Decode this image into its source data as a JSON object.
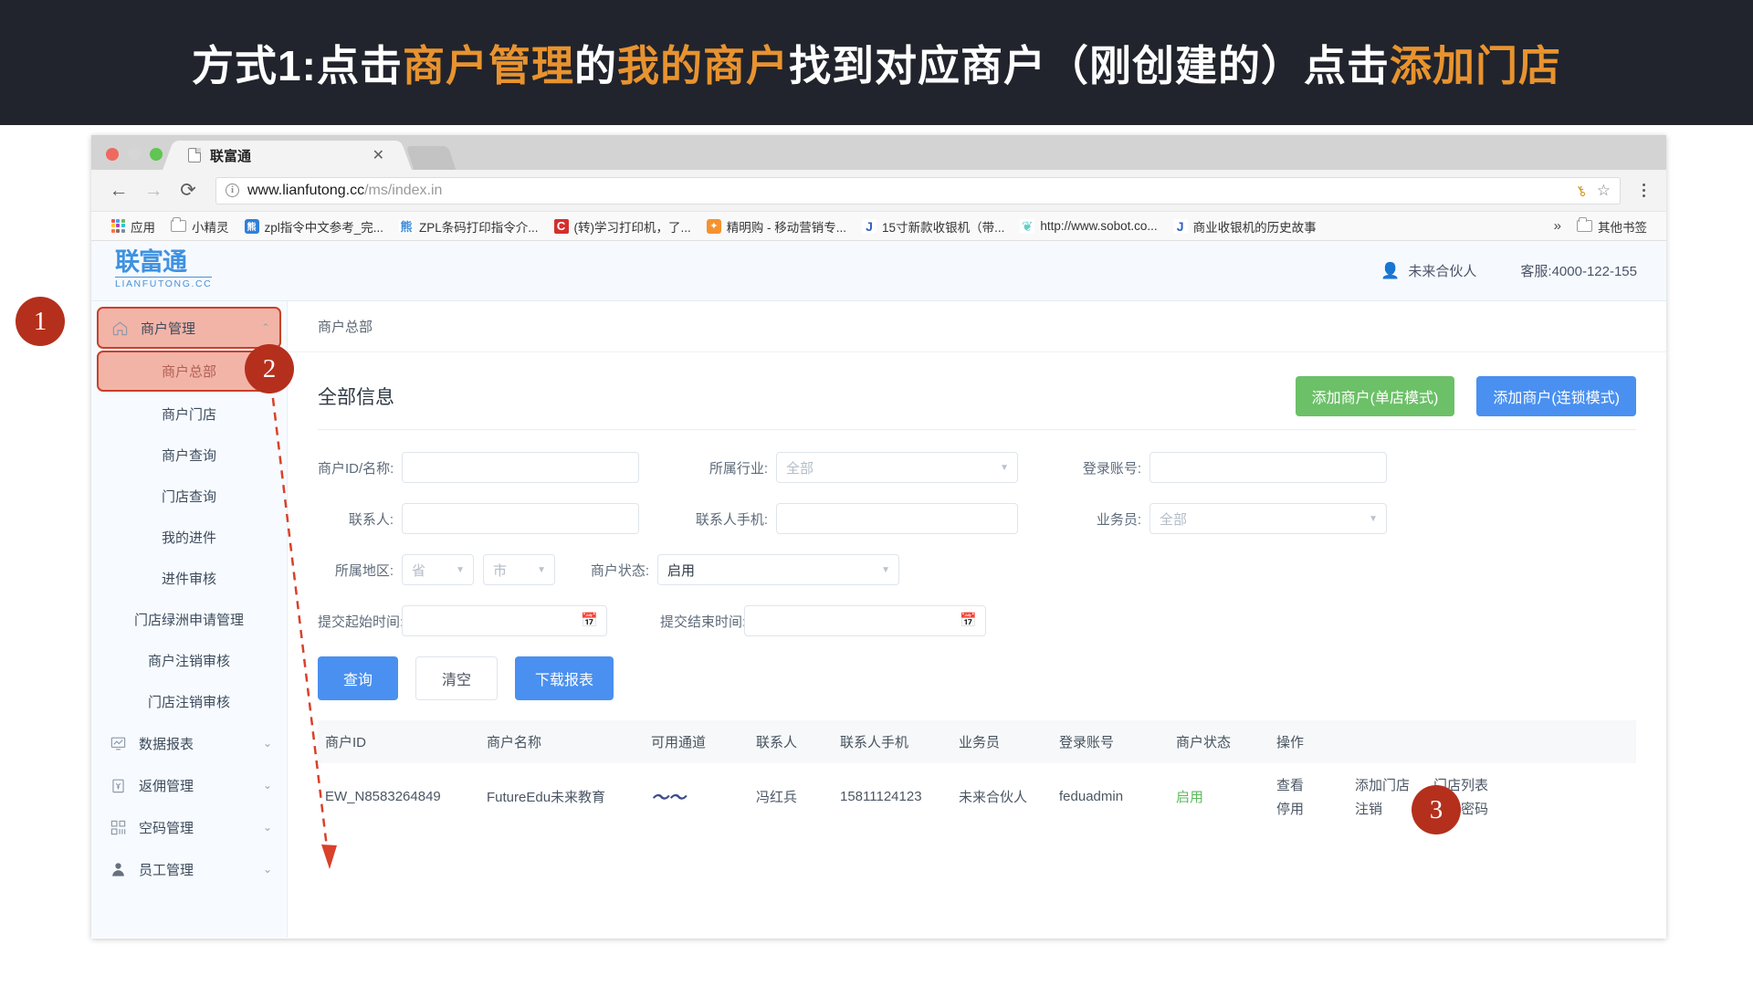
{
  "banner": {
    "seg1": "方式1:点击",
    "hl1": "商户管理",
    "seg2": "的",
    "hl2": "我的商户",
    "seg3": "找到对应商户（刚创建的）点击",
    "hl3": "添加门店"
  },
  "browser": {
    "tab_title": "联富通",
    "tab_close": "✕",
    "back": "←",
    "forward": "→",
    "reload": "⟳",
    "url_host": "www.lianfutong.cc",
    "url_path": "/ms/index.in",
    "info_icon": "i",
    "key_icon": "⚷",
    "star_icon": "☆",
    "bookmarks": [
      {
        "label": "应用",
        "icon": "apps-grid-icon"
      },
      {
        "label": "小精灵",
        "icon": "folder-icon"
      },
      {
        "label": "zpl指令中文参考_完...",
        "icon": "baidu-icon"
      },
      {
        "label": "ZPL条码打印指令介...",
        "icon": "baidu-alt-icon"
      },
      {
        "label": "(转)学习打印机，了...",
        "icon": "csdn-icon"
      },
      {
        "label": "精明购 - 移动营销专...",
        "icon": "orange-bag-icon"
      },
      {
        "label": "15寸新款收银机（带...",
        "icon": "jd-icon"
      },
      {
        "label": "http://www.sobot.co...",
        "icon": "tooth-icon"
      },
      {
        "label": "商业收银机的历史故事",
        "icon": "jd-icon"
      }
    ],
    "more_chevron": "»",
    "other_bookmarks": "其他书签",
    "other_bookmarks_icon": "folder-icon"
  },
  "site": {
    "logo_main": "联富通",
    "logo_sub": "LIANFUTONG.CC",
    "user_name": "未来合伙人",
    "user_icon": "user-avatar-icon",
    "service": "客服:4000-122-155",
    "breadcrumb": "商户总部"
  },
  "sidebar": {
    "groups": [
      {
        "label": "商户管理",
        "icon": "home-icon",
        "caret": "⌃",
        "active": true,
        "children": [
          {
            "label": "商户总部",
            "active": true
          },
          {
            "label": "商户门店",
            "active": false
          },
          {
            "label": "商户查询",
            "active": false
          },
          {
            "label": "门店查询",
            "active": false
          },
          {
            "label": "我的进件",
            "active": false
          },
          {
            "label": "进件审核",
            "active": false
          },
          {
            "label": "门店绿洲申请管理",
            "active": false
          },
          {
            "label": "商户注销审核",
            "active": false
          },
          {
            "label": "门店注销审核",
            "active": false
          }
        ]
      },
      {
        "label": "数据报表",
        "icon": "chart-monitor-icon",
        "caret": "⌄",
        "active": false,
        "children": []
      },
      {
        "label": "返佣管理",
        "icon": "yuan-note-icon",
        "caret": "⌄",
        "active": false,
        "children": []
      },
      {
        "label": "空码管理",
        "icon": "qrcode-icon",
        "caret": "⌄",
        "active": false,
        "children": []
      },
      {
        "label": "员工管理",
        "icon": "user-icon",
        "caret": "⌄",
        "active": false,
        "children": []
      }
    ]
  },
  "panel": {
    "title": "全部信息",
    "btn_single": "添加商户(单店模式)",
    "btn_chain": "添加商户(连锁模式)",
    "color_green": "#6cc068",
    "color_blue": "#4a90f0"
  },
  "form": {
    "merchant_id_label": "商户ID/名称:",
    "merchant_id_value": "",
    "industry_label": "所属行业:",
    "industry_value": "全部",
    "login_account_label": "登录账号:",
    "login_account_value": "",
    "contact_label": "联系人:",
    "contact_value": "",
    "contact_phone_label": "联系人手机:",
    "contact_phone_value": "",
    "salesman_label": "业务员:",
    "salesman_value": "全部",
    "region_label": "所属地区:",
    "province_value": "省",
    "city_value": "市",
    "status_label": "商户状态:",
    "status_value": "启用",
    "start_time_label": "提交起始时间:",
    "start_time_value": "",
    "end_time_label": "提交结束时间:",
    "end_time_value": "",
    "calendar_icon": "calendar-icon",
    "dropdown_icon": "chevron-down-icon",
    "btn_query": "查询",
    "btn_clear": "清空",
    "btn_download": "下载报表"
  },
  "table": {
    "headers": [
      "商户ID",
      "商户名称",
      "可用通道",
      "联系人",
      "联系人手机",
      "业务员",
      "登录账号",
      "商户状态",
      "操作"
    ],
    "rows": [
      {
        "merchant_id": "EW_N8583264849",
        "merchant_name": "FutureEdu未来教育",
        "channel_icon": "wave-channel-icon",
        "contact": "冯红兵",
        "phone": "15811124123",
        "salesman": "未来合伙人",
        "login_account": "feduadmin",
        "status": "启用",
        "ops": [
          [
            "查看",
            "停用"
          ],
          [
            "添加门店",
            "注销"
          ],
          [
            "门店列表",
            "重置密码"
          ]
        ]
      }
    ]
  },
  "annotations": {
    "badge1": "1",
    "badge2": "2",
    "badge3": "3"
  }
}
